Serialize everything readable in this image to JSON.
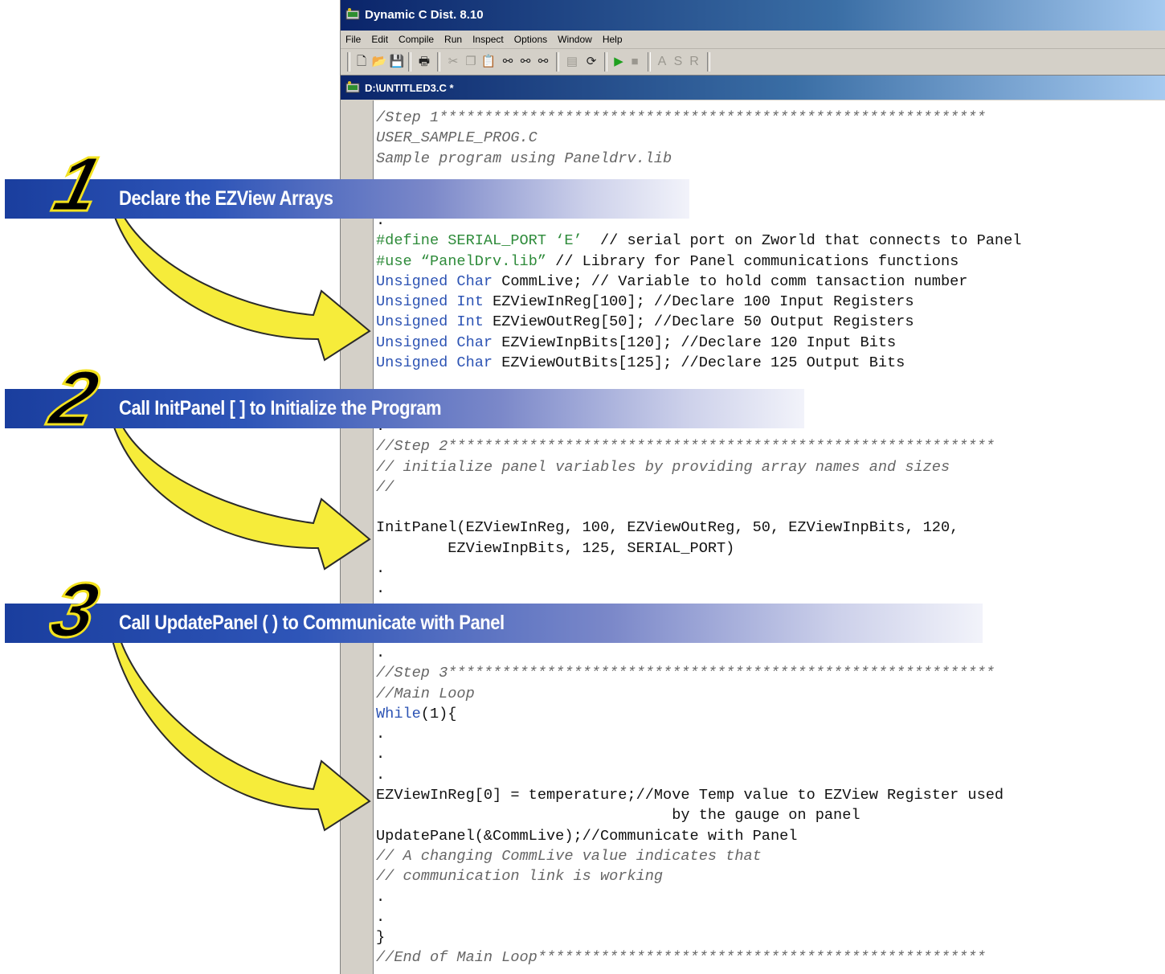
{
  "window": {
    "title": "Dynamic C Dist. 8.10",
    "menu": [
      "File",
      "Edit",
      "Compile",
      "Run",
      "Inspect",
      "Options",
      "Window",
      "Help"
    ],
    "toolbar_letters": [
      "A",
      "S",
      "R"
    ],
    "document_title": "D:\\UNTITLED3.C *"
  },
  "steps": [
    {
      "number": "1",
      "label": "Declare the EZView Arrays"
    },
    {
      "number": "2",
      "label": "Call InitPanel [ ] to Initialize the Program"
    },
    {
      "number": "3",
      "label": "Call UpdatePanel ( ) to Communicate with  Panel"
    }
  ],
  "code": {
    "header": {
      "l1": "/Step 1*************************************************************",
      "l2": "USER_SAMPLE_PROG.C",
      "l3": "Sample program using Paneldrv.lib"
    },
    "decl": {
      "dot": ".",
      "define_kw": "#define SERIAL_PORT ",
      "define_val": "‘E’",
      "define_cm": "  // serial port on Zworld that connects to Panel",
      "use_kw": "#use ",
      "use_val": "“PanelDrv.lib”",
      "use_cm": " // Library for Panel communications functions",
      "d1_kw": "Unsigned Char",
      "d1": " CommLive; // Variable to hold comm tansaction number",
      "d2_kw": "Unsigned Int",
      "d2": " EZViewInReg[100]; //Declare 100 Input Registers",
      "d3_kw": "Unsigned Int",
      "d3": " EZViewOutReg[50]; //Declare 50 Output Registers",
      "d4_kw": "Unsigned Char",
      "d4": " EZViewInpBits[120]; //Declare 120 Input Bits",
      "d5_kw": "Unsigned Char",
      "d5": " EZViewOutBits[125]; //Declare 125 Output Bits"
    },
    "step2": {
      "dot": ".",
      "l1": "//Step 2*************************************************************",
      "l2": "// initialize panel variables by providing array names and sizes",
      "l3": "//",
      "init1": "InitPanel(EZViewInReg, 100, EZViewOutReg, 50, EZViewInpBits, 120,",
      "init2": "        EZViewInpBits, 125, SERIAL_PORT)",
      "dot2": ".",
      "dot3": "."
    },
    "step3": {
      "dot": ".",
      "l1": "//Step 3*************************************************************",
      "l2": "//Main Loop",
      "while_kw": "While",
      "while_rest": "(1){",
      "dot1": ".",
      "dot2": ".",
      "dot3": ".",
      "assign1": "EZViewInReg[0] = temperature;//Move Temp value to EZView Register used",
      "assign2": "                                 by the gauge on panel",
      "update": "UpdatePanel(&CommLive);//Communicate with Panel",
      "c1": "// A changing CommLive value indicates that",
      "c2": "// communication link is working",
      "dot4": ".",
      "dot5": ".",
      "close": "}",
      "end": "//End of Main Loop**************************************************"
    }
  },
  "colors": {
    "banner_start": "#1a3e9e",
    "number_fill": "#000000",
    "number_outline": "#f3e21e",
    "arrow_fill": "#f6ec3a",
    "keyword": "#2c53b4",
    "preprocessor": "#2e8b3a",
    "comment": "#666666"
  },
  "icons": [
    "app-icon",
    "new-file-icon",
    "open-folder-icon",
    "save-icon",
    "print-icon",
    "cut-icon",
    "copy-icon",
    "paste-icon",
    "find-icon",
    "find-next-icon",
    "replace-icon",
    "compile-icon",
    "debug-icon",
    "run-icon",
    "stop-icon"
  ]
}
